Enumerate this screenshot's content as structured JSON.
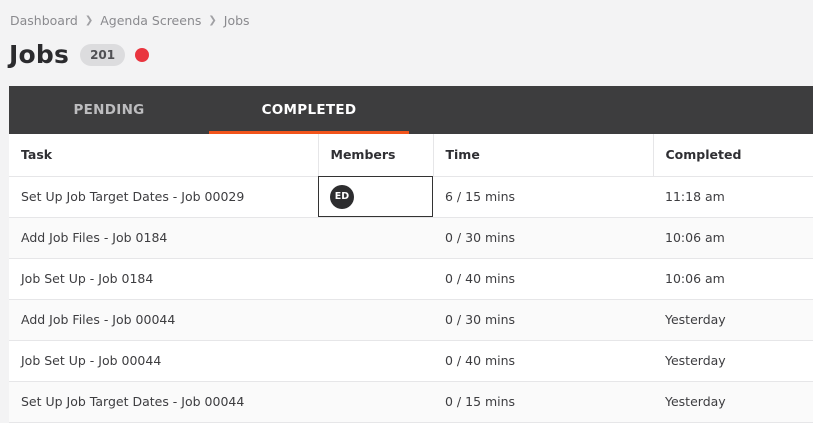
{
  "breadcrumb": {
    "items": [
      "Dashboard",
      "Agenda Screens",
      "Jobs"
    ]
  },
  "page": {
    "title": "Jobs",
    "count": "201",
    "status_color": "#e9353f"
  },
  "tabs": [
    {
      "label": "PENDING",
      "active": false
    },
    {
      "label": "COMPLETED",
      "active": true
    }
  ],
  "table": {
    "columns": [
      "Task",
      "Members",
      "Time",
      "Completed"
    ],
    "rows": [
      {
        "task": "Set Up Job Target Dates - Job 00029",
        "member": "ED",
        "time": "6 / 15 mins",
        "completed": "11:18 am"
      },
      {
        "task": "Add Job Files - Job 0184",
        "member": "",
        "time": "0 / 30 mins",
        "completed": "10:06 am"
      },
      {
        "task": "Job Set Up - Job 0184",
        "member": "",
        "time": "0 / 40 mins",
        "completed": "10:06 am"
      },
      {
        "task": "Add Job Files - Job 00044",
        "member": "",
        "time": "0 / 30 mins",
        "completed": "Yesterday"
      },
      {
        "task": "Job Set Up - Job 00044",
        "member": "",
        "time": "0 / 40 mins",
        "completed": "Yesterday"
      },
      {
        "task": "Set Up Job Target Dates - Job 00044",
        "member": "",
        "time": "0 / 15 mins",
        "completed": "Yesterday"
      }
    ]
  },
  "colors": {
    "tab_bar": "#3d3d3e",
    "accent": "#f2541b"
  }
}
